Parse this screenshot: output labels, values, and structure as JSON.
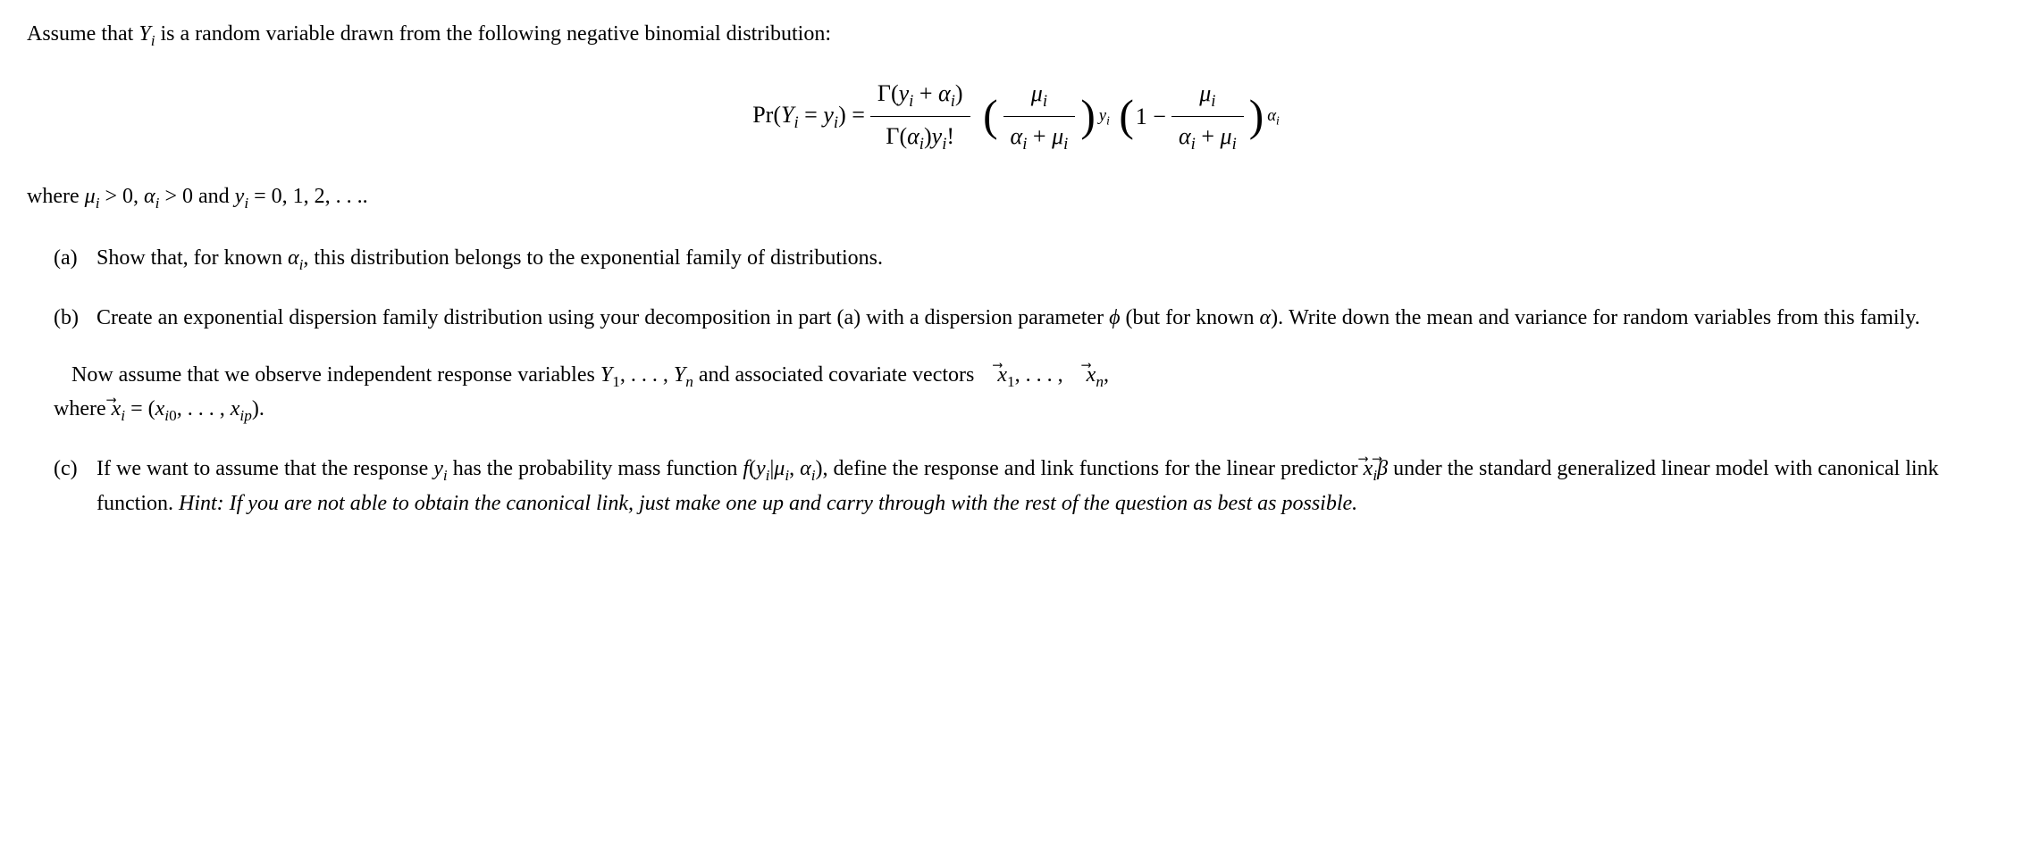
{
  "intro": "Assume that Yᵢ is a random variable drawn from the following negative binomial distribution:",
  "equation": {
    "lhs": "Pr(Yᵢ = yᵢ) =",
    "frac1_num": "Γ(yᵢ + αᵢ)",
    "frac1_den": "Γ(αᵢ)yᵢ!",
    "frac2_num": "μᵢ",
    "frac2_den": "αᵢ + μᵢ",
    "exp1": "yᵢ",
    "term2": "1 −",
    "frac3_num": "μᵢ",
    "frac3_den": "αᵢ + μᵢ",
    "exp2": "αᵢ"
  },
  "conditions": "where μᵢ > 0, αᵢ > 0 and yᵢ = 0, 1, 2, . . ..",
  "parts": {
    "a": {
      "label": "(a)",
      "text": "Show that, for known αᵢ, this distribution belongs to the exponential family of distributions."
    },
    "b": {
      "label": "(b)",
      "text": "Create an exponential dispersion family distribution using your decomposition in part (a) with a dispersion parameter ϕ (but for known α). Write down the mean and variance for random variables from this family."
    },
    "intermezzo": {
      "line1": "Now assume that we observe independent response variables Y₁, . . . , Yₙ and associated covariate vectors x⃗₁, . . . , x⃗ₙ,",
      "line2": "where x⃗ᵢ = (xᵢ₀, . . . , xᵢₚ)."
    },
    "c": {
      "label": "(c)",
      "text_plain": "If we want to assume that the response yᵢ has the probability mass function f(yᵢ|μᵢ, αᵢ), define the response and link functions for the linear predictor x⃗ᵢβ⃗ under the standard generalized linear model with canonical link function. ",
      "hint": "Hint: If you are not able to obtain the canonical link, just make one up and carry through with the rest of the question as best as possible."
    }
  }
}
